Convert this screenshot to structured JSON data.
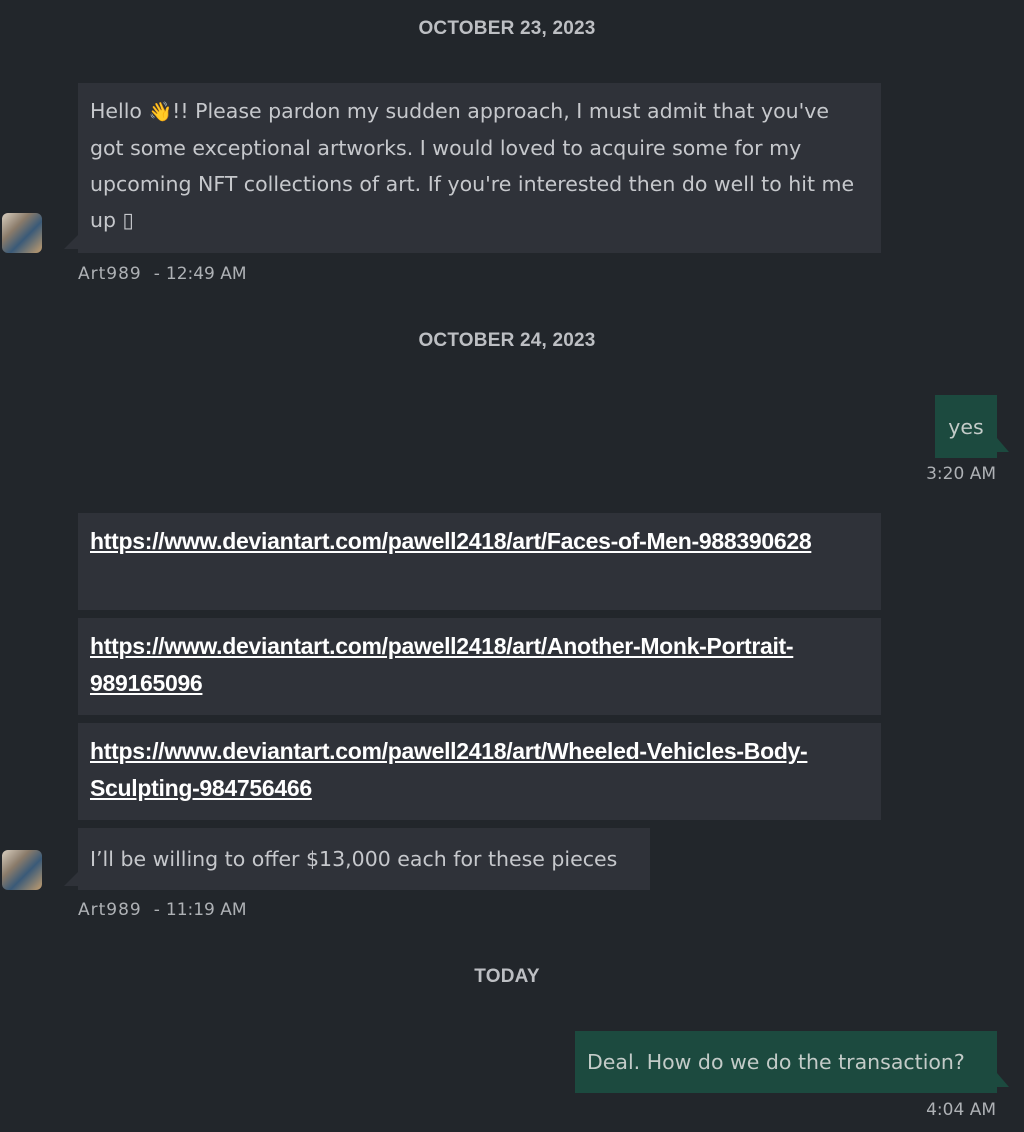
{
  "dates": {
    "d1": "OCTOBER 23, 2023",
    "d2": "OCTOBER 24, 2023",
    "d3": "TODAY"
  },
  "messages": {
    "m1": {
      "text_before_icon": "Hello ",
      "icon": "waving-hand-icon",
      "text_after_icon": "!! Please pardon my sudden approach, I must admit that you've got some exceptional artworks. I would loved to acquire some for my upcoming NFT collections of art. If you're interested then do well to hit me up ▯",
      "user": "Art989",
      "separator": "-",
      "time": "12:49 AM"
    },
    "m2": {
      "text": "yes",
      "time": "3:20 AM"
    },
    "m3": {
      "links": [
        "https://www.deviantart.com/pawell2418/art/Faces-of-Men-988390628",
        "https://www.deviantart.com/pawell2418/art/Another-Monk-Portrait-989165096",
        "https://www.deviantart.com/pawell2418/art/Wheeled-Vehicles-Body-Sculpting-984756466"
      ],
      "text": "I’ll be willing to offer $13,000 each for these pieces",
      "user": "Art989",
      "separator": "-",
      "time": "11:19 AM"
    },
    "m4": {
      "text": "Deal. How do we do the transaction?",
      "time": "4:04 AM"
    }
  },
  "colors": {
    "background": "#22262b",
    "incoming_bubble": "#2f3239",
    "outgoing_bubble": "#1c4a3f"
  }
}
